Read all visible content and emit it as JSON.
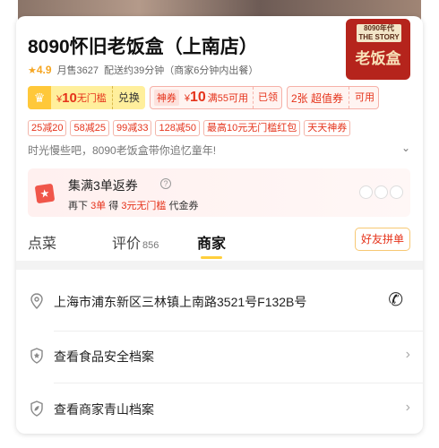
{
  "store": {
    "name": "8090怀旧老饭盒（上南店）",
    "rating": "4.9",
    "monthly_sales": "月售3627",
    "delivery": "配送约39分钟（商家6分钟内出餐）",
    "logo_top": "8090年代 THE STORY",
    "logo_main": "老饭盒"
  },
  "coupons": {
    "vip_currency": "¥",
    "vip_amount": "10",
    "vip_text": "无门槛",
    "vip_button": "兑换",
    "shen_tag": "神券",
    "shen_currency": "¥",
    "shen_amount": "10",
    "shen_cond": "满55可用",
    "shen_status": "已领",
    "voucher_label": "2张 超值券",
    "voucher_button": "可用"
  },
  "discounts": [
    "25减20",
    "58减25",
    "99减33",
    "128减50",
    "最高10元无门槛红包",
    "天天神券"
  ],
  "slogan": "时光慢些吧，8090老饭盒带你追忆童年!",
  "fanquan": {
    "title": "集满3单返券",
    "help": "?",
    "sub_prefix": "再下",
    "sub_count": "3单",
    "sub_mid": "得",
    "sub_reward": "3元无门槛",
    "sub_suffix": "代金券"
  },
  "tabs": [
    {
      "label": "点菜",
      "count": ""
    },
    {
      "label": "评价",
      "count": "856"
    },
    {
      "label": "商家",
      "count": ""
    }
  ],
  "friend_button": "好友拼单",
  "info_rows": {
    "address": "上海市浦东新区三林镇上南路3521号F132B号",
    "food_safety": "查看食品安全档案",
    "green_file": "查看商家青山档案"
  },
  "colors": {
    "accent_red": "#e5331b",
    "accent_yellow": "#ffcf3c"
  }
}
